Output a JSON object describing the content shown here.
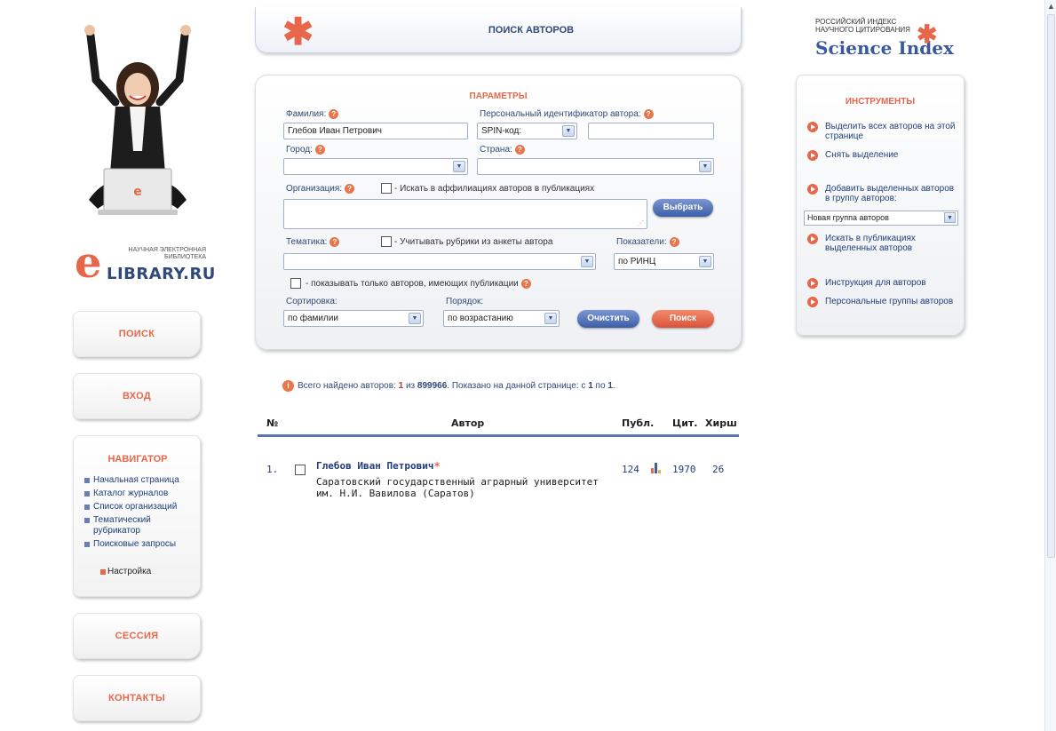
{
  "header": {
    "title": "ПОИСК АВТОРОВ",
    "star_glyph": "✱"
  },
  "science_index": {
    "line1": "РОССИЙСКИЙ ИНДЕКС",
    "line2": "НАУЧНОГО ЦИТИРОВАНИЯ",
    "brand": "Science Index",
    "star_glyph": "✱"
  },
  "logo": {
    "e_glyph": "e",
    "tagline_1": "НАУЧНАЯ ЭЛЕКТРОННАЯ",
    "tagline_2": "БИБЛИОТЕКА",
    "brand": "LIBRARY.RU"
  },
  "sidebar": {
    "search_label": "ПОИСК",
    "login_label": "ВХОД",
    "navigator": {
      "title": "НАВИГАТОР",
      "items": [
        {
          "label": "Начальная страница"
        },
        {
          "label": "Каталог журналов"
        },
        {
          "label": "Список организаций"
        },
        {
          "label": "Тематический рубрикатор"
        },
        {
          "label": "Поисковые запросы"
        }
      ],
      "settings_label": "Настройка"
    },
    "session_label": "СЕССИЯ",
    "contacts_label": "КОНТАКТЫ"
  },
  "params": {
    "title": "ПАРАМЕТРЫ",
    "help_glyph": "?",
    "surname_label": "Фамилия:",
    "surname_value": "Глебов Иван Петрович",
    "author_id_label": "Персональный идентификатор автора:",
    "id_type_value": "SPIN-код:",
    "id_value": "",
    "city_label": "Город:",
    "city_value": "",
    "country_label": "Страна:",
    "country_value": "",
    "org_label": "Организация:",
    "org_affil_label": "- Искать в аффилиациях авторов в публикациях",
    "choose_button": "Выбрать",
    "topic_label": "Тематика:",
    "topic_rubrics_label": "- Учитывать рубрики из анкеты автора",
    "topic_value": "",
    "indicators_label": "Показатели:",
    "indicators_value": "по РИНЦ",
    "only_with_pubs_label": "- показывать только авторов, имеющих публикации",
    "sort_label": "Сортировка:",
    "sort_value": "по фамилии",
    "order_label": "Порядок:",
    "order_value": "по возрастанию",
    "clear_button": "Очистить",
    "search_button": "Поиск",
    "dropdown_glyph": "▼"
  },
  "tools": {
    "title": "ИНСТРУМЕНТЫ",
    "select_all": "Выделить всех авторов на этой странице",
    "deselect": "Снять выделение",
    "add_to_group": "Добавить выделенных авторов в группу авторов:",
    "group_value": "Новая группа авторов",
    "search_in_pubs": "Искать в публикациях выделенных авторов",
    "instructions": "Инструкция для авторов",
    "personal_groups": "Персональные группы авторов"
  },
  "results": {
    "info_glyph": "i",
    "summary_prefix": "Всего найдено авторов:",
    "found": "1",
    "of_word": "из",
    "total": "899966",
    "shown_prefix": ". Показано на данной странице: с",
    "shown_from": "1",
    "to_word": "по",
    "shown_to": "1",
    "shown_suffix": ".",
    "columns": {
      "num": "№",
      "author": "Автор",
      "pubs": "Публ.",
      "cit": "Цит.",
      "hirsch": "Хирш"
    },
    "rows": [
      {
        "num": "1.",
        "name": "Глебов Иван Петрович",
        "star": "*",
        "affiliation": "Саратовский государственный аграрный университет им. Н.И. Вавилова (Саратов)",
        "pubs": "124",
        "cit": "1970",
        "hirsch": "26"
      }
    ]
  },
  "colors": {
    "accent_orange": "#e8674a",
    "brand_blue": "#2f4a7a",
    "link_blue": "#1f3e7a"
  }
}
